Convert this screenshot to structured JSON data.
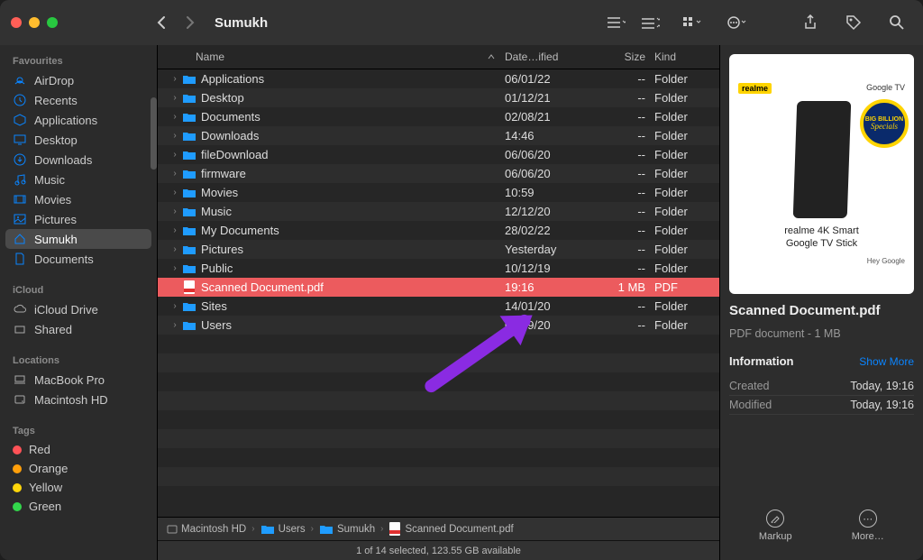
{
  "window": {
    "title": "Sumukh"
  },
  "sidebar": {
    "sections": [
      {
        "title": "Favourites",
        "items": [
          {
            "label": "AirDrop",
            "icon": "airdrop"
          },
          {
            "label": "Recents",
            "icon": "clock"
          },
          {
            "label": "Applications",
            "icon": "app"
          },
          {
            "label": "Desktop",
            "icon": "desktop"
          },
          {
            "label": "Downloads",
            "icon": "download"
          },
          {
            "label": "Music",
            "icon": "music"
          },
          {
            "label": "Movies",
            "icon": "movie"
          },
          {
            "label": "Pictures",
            "icon": "picture"
          },
          {
            "label": "Sumukh",
            "icon": "home",
            "selected": true
          },
          {
            "label": "Documents",
            "icon": "doc"
          }
        ]
      },
      {
        "title": "iCloud",
        "items": [
          {
            "label": "iCloud Drive",
            "icon": "cloud",
            "gray": true
          },
          {
            "label": "Shared",
            "icon": "shared",
            "gray": true
          }
        ]
      },
      {
        "title": "Locations",
        "items": [
          {
            "label": "MacBook Pro",
            "icon": "laptop",
            "gray": true
          },
          {
            "label": "Macintosh HD",
            "icon": "disk",
            "gray": true
          }
        ]
      },
      {
        "title": "Tags",
        "items": [
          {
            "label": "Red",
            "tag": "#ff5257"
          },
          {
            "label": "Orange",
            "tag": "#ff9f0a"
          },
          {
            "label": "Yellow",
            "tag": "#ffd60a"
          },
          {
            "label": "Green",
            "tag": "#32d74b"
          }
        ]
      }
    ]
  },
  "columns": {
    "name": "Name",
    "date": "Date…ified",
    "size": "Size",
    "kind": "Kind"
  },
  "files": [
    {
      "name": "Applications",
      "date": "06/01/22",
      "size": "--",
      "kind": "Folder",
      "type": "folder"
    },
    {
      "name": "Desktop",
      "date": "01/12/21",
      "size": "--",
      "kind": "Folder",
      "type": "folder"
    },
    {
      "name": "Documents",
      "date": "02/08/21",
      "size": "--",
      "kind": "Folder",
      "type": "folder"
    },
    {
      "name": "Downloads",
      "date": "14:46",
      "size": "--",
      "kind": "Folder",
      "type": "folder"
    },
    {
      "name": "fileDownload",
      "date": "06/06/20",
      "size": "--",
      "kind": "Folder",
      "type": "folder"
    },
    {
      "name": "firmware",
      "date": "06/06/20",
      "size": "--",
      "kind": "Folder",
      "type": "folder"
    },
    {
      "name": "Movies",
      "date": "10:59",
      "size": "--",
      "kind": "Folder",
      "type": "folder"
    },
    {
      "name": "Music",
      "date": "12/12/20",
      "size": "--",
      "kind": "Folder",
      "type": "folder"
    },
    {
      "name": "My Documents",
      "date": "28/02/22",
      "size": "--",
      "kind": "Folder",
      "type": "folder"
    },
    {
      "name": "Pictures",
      "date": "Yesterday",
      "size": "--",
      "kind": "Folder",
      "type": "folder"
    },
    {
      "name": "Public",
      "date": "10/12/19",
      "size": "--",
      "kind": "Folder",
      "type": "folder"
    },
    {
      "name": "Scanned Document.pdf",
      "date": "19:16",
      "size": "1 MB",
      "kind": "PDF",
      "type": "pdf",
      "selected": true
    },
    {
      "name": "Sites",
      "date": "14/01/20",
      "size": "--",
      "kind": "Folder",
      "type": "folder"
    },
    {
      "name": "Users",
      "date": "04/09/20",
      "size": "--",
      "kind": "Folder",
      "type": "folder"
    }
  ],
  "pathbar": [
    "Macintosh HD",
    "Users",
    "Sumukh",
    "Scanned Document.pdf"
  ],
  "status": "1 of 14 selected, 123.55 GB available",
  "preview": {
    "brand_left": "realme",
    "brand_right": "Google TV",
    "badge_top": "BIG BILLION",
    "badge_bottom": "Specials",
    "product_line1": "realme 4K Smart",
    "product_line2": "Google TV Stick",
    "hey": "Hey Google",
    "title": "Scanned Document.pdf",
    "subtitle": "PDF document - 1 MB",
    "info_heading": "Information",
    "show_more": "Show More",
    "rows": [
      {
        "k": "Created",
        "v": "Today, 19:16"
      },
      {
        "k": "Modified",
        "v": "Today, 19:16"
      }
    ],
    "actions": {
      "markup": "Markup",
      "more": "More…"
    }
  }
}
